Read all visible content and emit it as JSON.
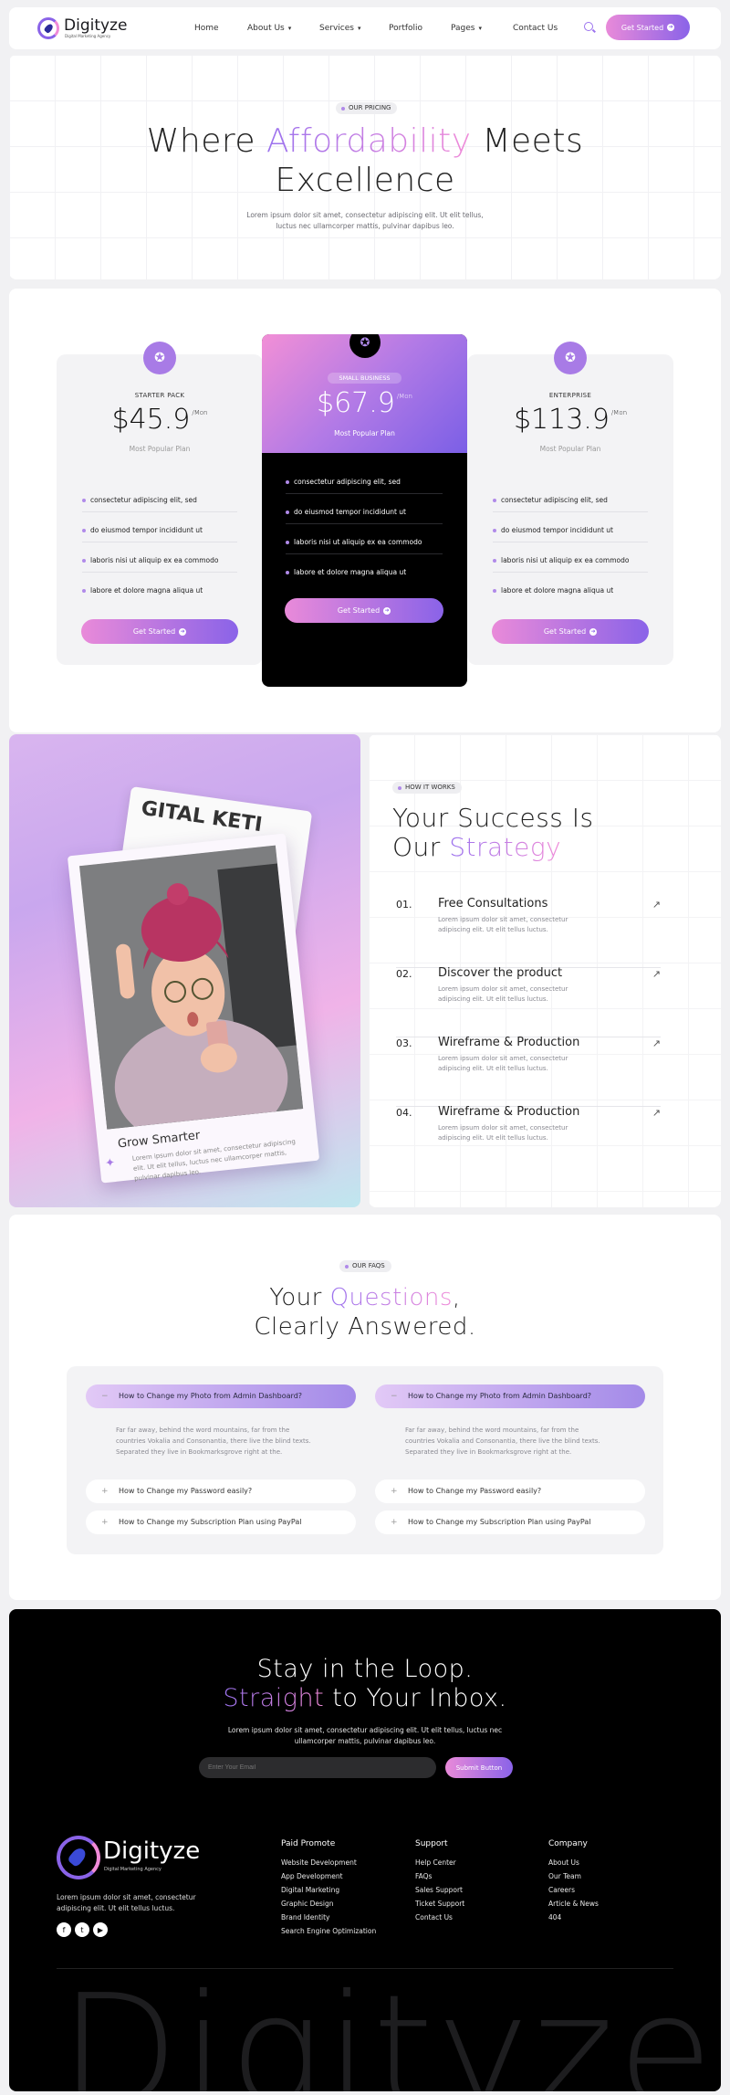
{
  "brand": {
    "name": "Digityze",
    "tagline": "Digital Marketing Agency"
  },
  "nav": {
    "items": [
      "Home",
      "About Us",
      "Services",
      "Portfolio",
      "Pages",
      "Contact Us"
    ],
    "cta": "Get Started"
  },
  "hero": {
    "tag": "OUR PRICING",
    "title_a": "Where ",
    "title_b": "Affordability",
    "title_c": " Meets",
    "title_d": "Excellence",
    "desc": "Lorem ipsum dolor sit amet, consectetur adipiscing elit. Ut elit tellus, luctus nec ullamcorper mattis, pulvinar dapibus leo."
  },
  "pricing": {
    "plans": [
      {
        "name": "STARTER PACK",
        "price": "$45.9",
        "per": "/Mon",
        "sub": "Most Popular Plan"
      },
      {
        "name": "SMALL BUSINESS",
        "price": "$67.9",
        "per": "/Mon",
        "sub": "Most Popular Plan"
      },
      {
        "name": "ENTERPRISE",
        "price": "$113.9",
        "per": "/Mon",
        "sub": "Most Popular Plan"
      }
    ],
    "features": [
      "consectetur adipiscing elit, sed",
      "do eiusmod tempor incididunt ut",
      "laboris nisi ut aliquip ex ea commodo",
      "labore et dolore magna aliqua ut"
    ],
    "button": "Get Started"
  },
  "how": {
    "tag": "HOW IT WORKS",
    "title_a": "Your Success Is",
    "title_b": "Our ",
    "title_c": "Strategy",
    "photo_caption": "Grow Smarter",
    "photo_desc": "Lorem ipsum dolor sit amet, consectetur adipiscing elit. Ut elit tellus, luctus nec ullamcorper mattis, pulvinar dapibus leo.",
    "photo_sign": "GITAL KETI",
    "steps": [
      {
        "num": "01.",
        "title": "Free Consultations",
        "desc": "Lorem ipsum dolor sit amet, consectetur adipiscing elit. Ut elit tellus luctus."
      },
      {
        "num": "02.",
        "title": "Discover the product",
        "desc": "Lorem ipsum dolor sit amet, consectetur adipiscing elit. Ut elit tellus luctus."
      },
      {
        "num": "03.",
        "title": "Wireframe & Production",
        "desc": "Lorem ipsum dolor sit amet, consectetur adipiscing elit. Ut elit tellus luctus."
      },
      {
        "num": "04.",
        "title": "Wireframe & Production",
        "desc": "Lorem ipsum dolor sit amet, consectetur adipiscing elit. Ut elit tellus luctus."
      }
    ]
  },
  "faqs": {
    "tag": "OUR FAQS",
    "title_a": "Your ",
    "title_b": "Questions",
    "title_c": ",",
    "title_d": "Clearly Answered.",
    "open_q": "How to Change my Photo from Admin Dashboard?",
    "answer": "Far far away, behind the word mountains, far from the countries Vokalia and Consonantia, there live the blind texts. Separated they live in Bookmarksgrove right at the.",
    "q2": "How to Change my Password easily?",
    "q3": "How to Change my Subscription Plan using PayPal"
  },
  "footer": {
    "title_a": "Stay in the Loop.",
    "title_b": "Straight",
    "title_c": " to Your Inbox.",
    "desc": "Lorem ipsum dolor sit amet, consectetur adipiscing elit. Ut elit tellus, luctus nec ullamcorper mattis, pulvinar dapibus leo.",
    "email_placeholder": "Enter Your Email",
    "submit": "Submit Button",
    "about": "Lorem ipsum dolor sit amet, consectetur adipiscing elit. Ut elit tellus luctus.",
    "cols": [
      {
        "title": "Paid Promote",
        "links": [
          "Website Development",
          "App Development",
          "Digital Marketing",
          "Graphic Design",
          "Brand Identity",
          "Search Engine Optimization"
        ]
      },
      {
        "title": "Support",
        "links": [
          "Help Center",
          "FAQs",
          "Sales Support",
          "Ticket Support",
          "Contact Us"
        ]
      },
      {
        "title": "Company",
        "links": [
          "About Us",
          "Our Team",
          "Careers",
          "Article & News",
          "404"
        ]
      }
    ],
    "socials": [
      "facebook-icon",
      "twitter-icon",
      "youtube-icon"
    ],
    "big_word": "Digityze"
  },
  "colors": {
    "accent_purple": "#8a63e8",
    "accent_pink": "#f08ad8",
    "dark": "#000000"
  }
}
